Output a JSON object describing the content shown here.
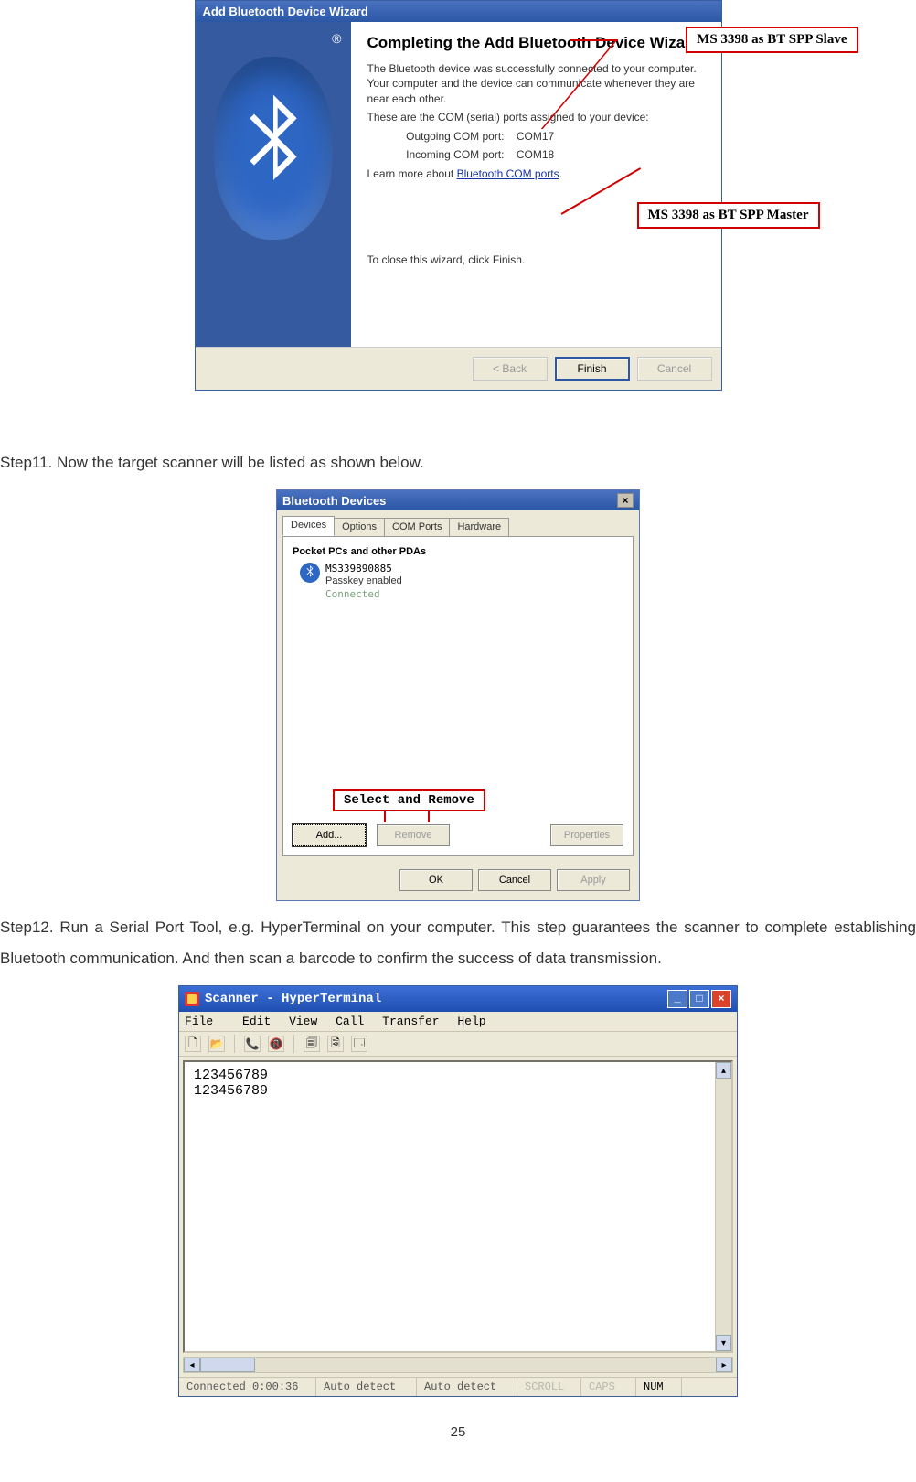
{
  "fig1": {
    "titlebar": "Add Bluetooth Device Wizard",
    "heading": "Completing the Add Bluetooth Device Wizard",
    "p1": "The Bluetooth device was successfully connected to your computer. Your computer and the device can communicate whenever they are near each other.",
    "p2": "These are the COM (serial) ports assigned to your device:",
    "outgoing_label": "Outgoing COM port:",
    "outgoing_value": "COM17",
    "incoming_label": "Incoming COM port:",
    "incoming_value": "COM18",
    "learn_prefix": "Learn more about ",
    "learn_link": "Bluetooth COM ports",
    "close_hint": "To close this wizard, click Finish.",
    "btn_back": "< Back",
    "btn_finish": "Finish",
    "btn_cancel": "Cancel",
    "callout_slave": "MS 3398 as BT SPP Slave",
    "callout_master": "MS 3398 as BT SPP Master"
  },
  "step11": "Step11. Now the target scanner will be listed as shown below.",
  "fig2": {
    "titlebar": "Bluetooth Devices",
    "tabs": [
      "Devices",
      "Options",
      "COM Ports",
      "Hardware"
    ],
    "section": "Pocket PCs and other PDAs",
    "device_name": "MS339890885",
    "device_passkey": "Passkey enabled",
    "device_status": "Connected",
    "btn_add": "Add...",
    "btn_remove": "Remove",
    "btn_properties": "Properties",
    "btn_ok": "OK",
    "btn_cancel": "Cancel",
    "btn_apply": "Apply",
    "callout": "Select and Remove"
  },
  "step12": "Step12. Run a Serial Port Tool, e.g. HyperTerminal on your computer.  This step guarantees the scanner to complete establishing Bluetooth communication.   And then scan a barcode to confirm the success of data transmission.",
  "fig3": {
    "titlebar": "Scanner - HyperTerminal",
    "menu": {
      "file": "File",
      "edit": "Edit",
      "view": "View",
      "call": "Call",
      "transfer": "Transfer",
      "help": "Help"
    },
    "terminal_lines": "123456789\n123456789",
    "status": {
      "connected": "Connected 0:00:36",
      "auto1": "Auto detect",
      "auto2": "Auto detect",
      "scroll": "SCROLL",
      "caps": "CAPS",
      "num": "NUM"
    }
  },
  "page_number": "25"
}
